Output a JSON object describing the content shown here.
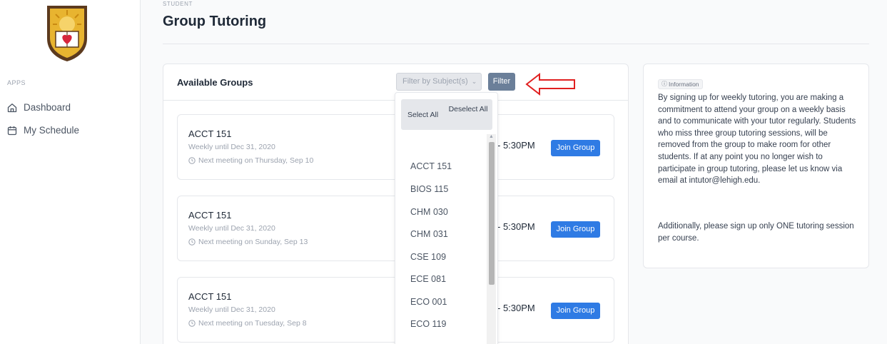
{
  "sidebar": {
    "apps_label": "APPS",
    "items": [
      {
        "label": "Dashboard",
        "icon": "home-icon"
      },
      {
        "label": "My Schedule",
        "icon": "calendar-icon"
      }
    ],
    "logo": "crest-logo"
  },
  "header": {
    "eyebrow": "STUDENT",
    "title": "Group Tutoring"
  },
  "groups": {
    "title": "Available Groups",
    "filter_placeholder": "Filter by Subject(s)",
    "filter_button": "Filter",
    "rows": [
      {
        "course": "ACCT 151",
        "weekly": "Weekly until Dec 31, 2020",
        "next": "Next meeting on Thursday, Sep 10",
        "time": "- 5:30PM",
        "join": "Join Group"
      },
      {
        "course": "ACCT 151",
        "weekly": "Weekly until Dec 31, 2020",
        "next": "Next meeting on Sunday, Sep 13",
        "time": "- 5:30PM",
        "join": "Join Group"
      },
      {
        "course": "ACCT 151",
        "weekly": "Weekly until Dec 31, 2020",
        "next": "Next meeting on Tuesday, Sep 8",
        "time": "- 5:30PM",
        "join": "Join Group"
      }
    ]
  },
  "dropdown": {
    "select_all": "Select All",
    "deselect_all": "Deselect All",
    "options": [
      "ACCT 151",
      "BIOS 115",
      "CHM 030",
      "CHM 031",
      "CSE 109",
      "ECE 081",
      "ECO 001",
      "ECO 119"
    ]
  },
  "info": {
    "badge": "Information",
    "paragraph1": "By signing up for weekly tutoring, you are making a commitment to attend your group on a weekly basis and to communicate with your tutor regularly. Students who miss three group tutoring sessions, will be removed from the group to make room for other students. If at any point you no longer wish to participate in group tutoring, please let us know via email at intutor@lehigh.edu.",
    "paragraph2": "Additionally, please sign up only ONE tutoring session per course."
  },
  "colors": {
    "primary": "#2f7be4",
    "filter_button": "#6b7f99",
    "annotation": "#e02020",
    "logo_brown": "#5c3a1e",
    "logo_gold": "#e8b430"
  }
}
